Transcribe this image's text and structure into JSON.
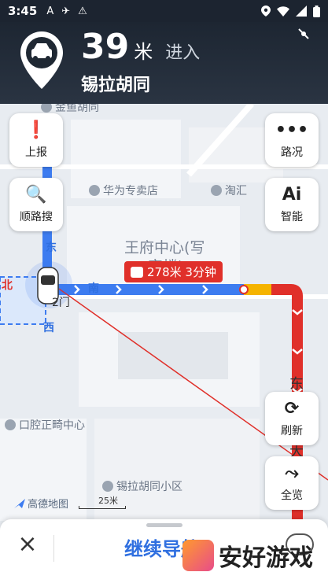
{
  "status_bar": {
    "time": "3:45",
    "left_icons": [
      "A",
      "✈",
      "⚠"
    ]
  },
  "navigation": {
    "distance": "39",
    "unit": "米",
    "action": "进入",
    "road_name": "锡拉胡同"
  },
  "map": {
    "pois": [
      "金鱼胡同",
      "华为专卖店",
      "淘汇",
      "王府中心(写",
      "字楼)",
      "口腔正畸中心",
      "锡拉胡同小区"
    ],
    "road_labels": [
      "东",
      "南",
      "北",
      "西",
      "2门",
      "东",
      "大"
    ],
    "route_bubble": "278米 3分钟",
    "logo": "高德地图",
    "scale": "25米",
    "colors": {
      "route_blue": "#3d7cf0",
      "route_yellow": "#f5b400",
      "route_red": "#e0302a"
    }
  },
  "side_buttons": {
    "report": "上报",
    "search_along": "顺路搜",
    "traffic": "路况",
    "ai": "智能",
    "refresh": "刷新",
    "overview": "全览"
  },
  "bottom_bar": {
    "continue_label": "继续导航"
  },
  "watermark": "安好游戏"
}
